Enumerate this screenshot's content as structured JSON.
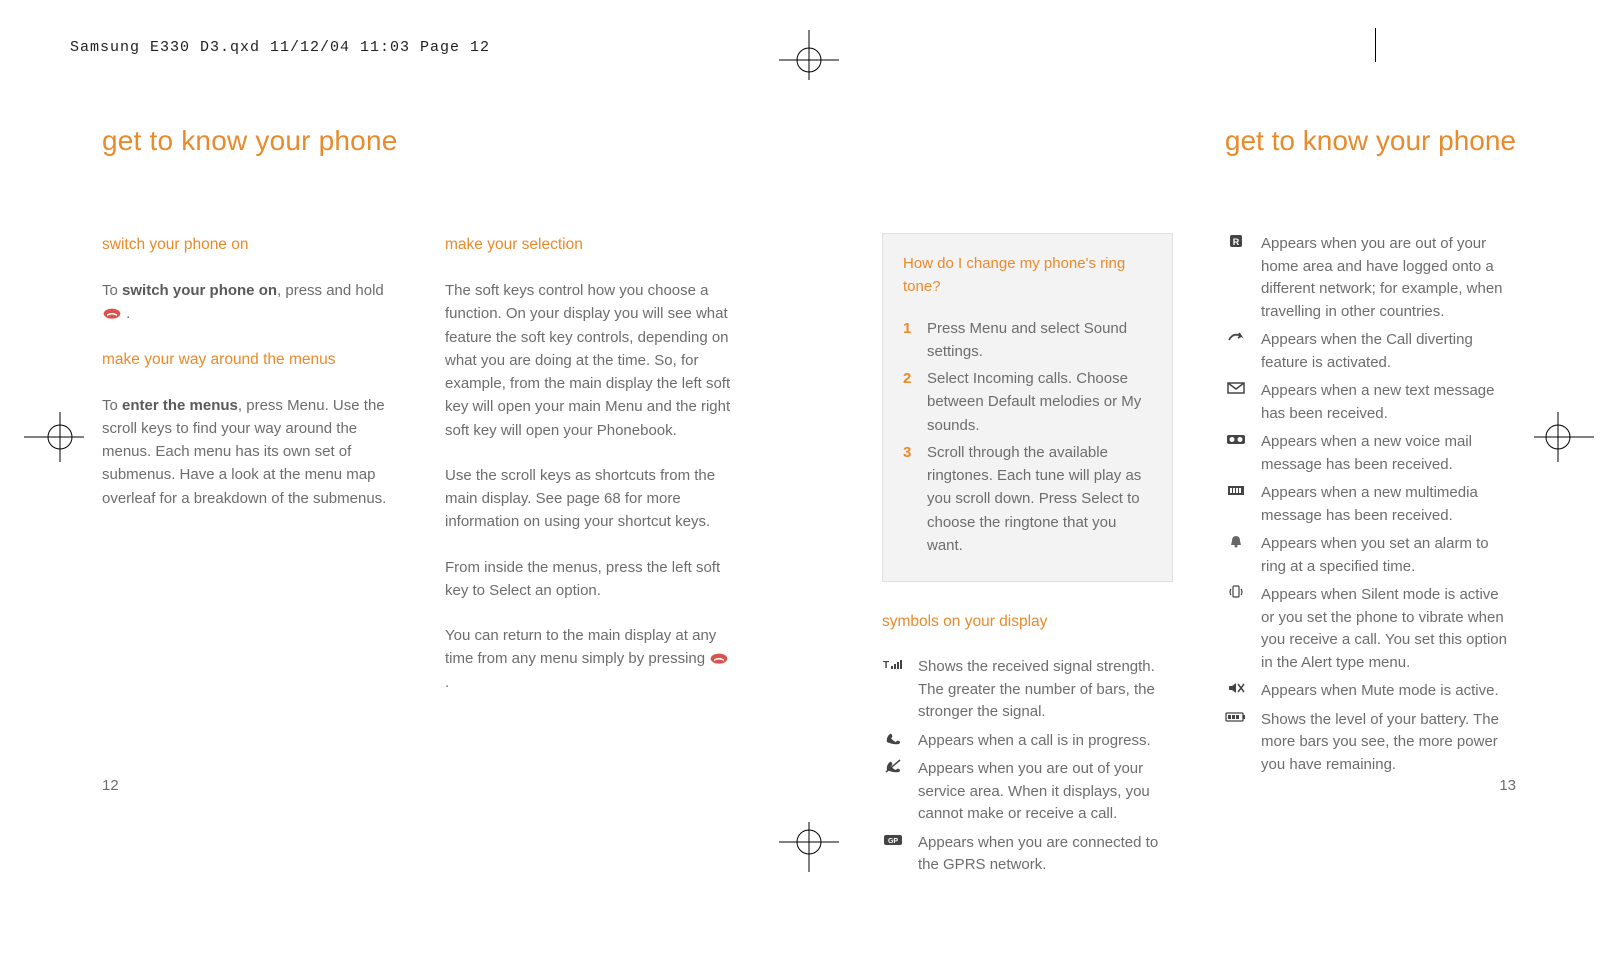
{
  "header_line": "Samsung E330 D3.qxd  11/12/04  11:03  Page 12",
  "title_left": "get to know your phone",
  "title_right": "get to know your phone",
  "page_num_left": "12",
  "page_num_right": "13",
  "left": {
    "col1": {
      "h1": "switch your phone on",
      "p1a": "To ",
      "p1b": "switch your phone on",
      "p1c": ", press and hold ",
      "p1d": " .",
      "h2": "make your way around the menus",
      "p2a": "To ",
      "p2b": "enter the menus",
      "p2c": ", press Menu. Use the scroll keys to find your way around the menus. Each menu has its own set of submenus. Have a look at the menu map overleaf for a breakdown of the submenus."
    },
    "col2": {
      "h1": "make your selection",
      "p1": "The soft keys control how you choose a function. On your display you will see what feature the soft key controls, depending on what you are doing at the time. So, for example, from the main display the left soft key will open your main Menu and the right soft key will open your Phonebook.",
      "p2": "Use the scroll keys as shortcuts from the main display. See page 68 for more information on using your shortcut keys.",
      "p3": "From inside the menus, press the left soft key to Select an option.",
      "p4a": "You can return to the main display at any time from any menu simply by pressing ",
      "p4b": " ."
    }
  },
  "right": {
    "tip": {
      "title": "How do I change my phone's ring tone?",
      "steps": [
        {
          "n": "1",
          "t": "Press Menu and select Sound settings."
        },
        {
          "n": "2",
          "t": "Select Incoming calls. Choose between Default melodies or My sounds."
        },
        {
          "n": "3",
          "t": "Scroll through the available ringtones. Each tune will play as you scroll down. Press Select to choose the ringtone that you want."
        }
      ]
    },
    "symbols_head": "symbols on your display",
    "symbols1": [
      {
        "icon": "signal",
        "t": "Shows the received signal strength. The greater the number of bars, the stronger the signal."
      },
      {
        "icon": "call",
        "t": "Appears when a call is in progress."
      },
      {
        "icon": "nosvc",
        "t": "Appears when you are out of your service area. When it displays, you cannot make or receive a call."
      },
      {
        "icon": "gprs",
        "t": "Appears when you are connected to the GPRS network."
      }
    ],
    "symbols2": [
      {
        "icon": "roam",
        "t": "Appears when you are out of your home area and have logged onto a different network; for example, when travelling in other countries."
      },
      {
        "icon": "divert",
        "t": "Appears when the Call diverting feature is activated."
      },
      {
        "icon": "sms",
        "t": "Appears when a new text message has been received."
      },
      {
        "icon": "vmail",
        "t": "Appears when a new voice mail message has been received."
      },
      {
        "icon": "mms",
        "t": "Appears when a new multimedia message has been received."
      },
      {
        "icon": "alarm",
        "t": "Appears when you set an alarm to ring at a specified time."
      },
      {
        "icon": "silent",
        "t": "Appears when Silent mode is active or you set the phone to vibrate when you receive a call. You set this option in the Alert type menu."
      },
      {
        "icon": "mute",
        "t": "Appears when Mute mode is active."
      },
      {
        "icon": "battery",
        "t": "Shows the level of your battery. The more bars you see, the more power you have remaining."
      }
    ]
  }
}
